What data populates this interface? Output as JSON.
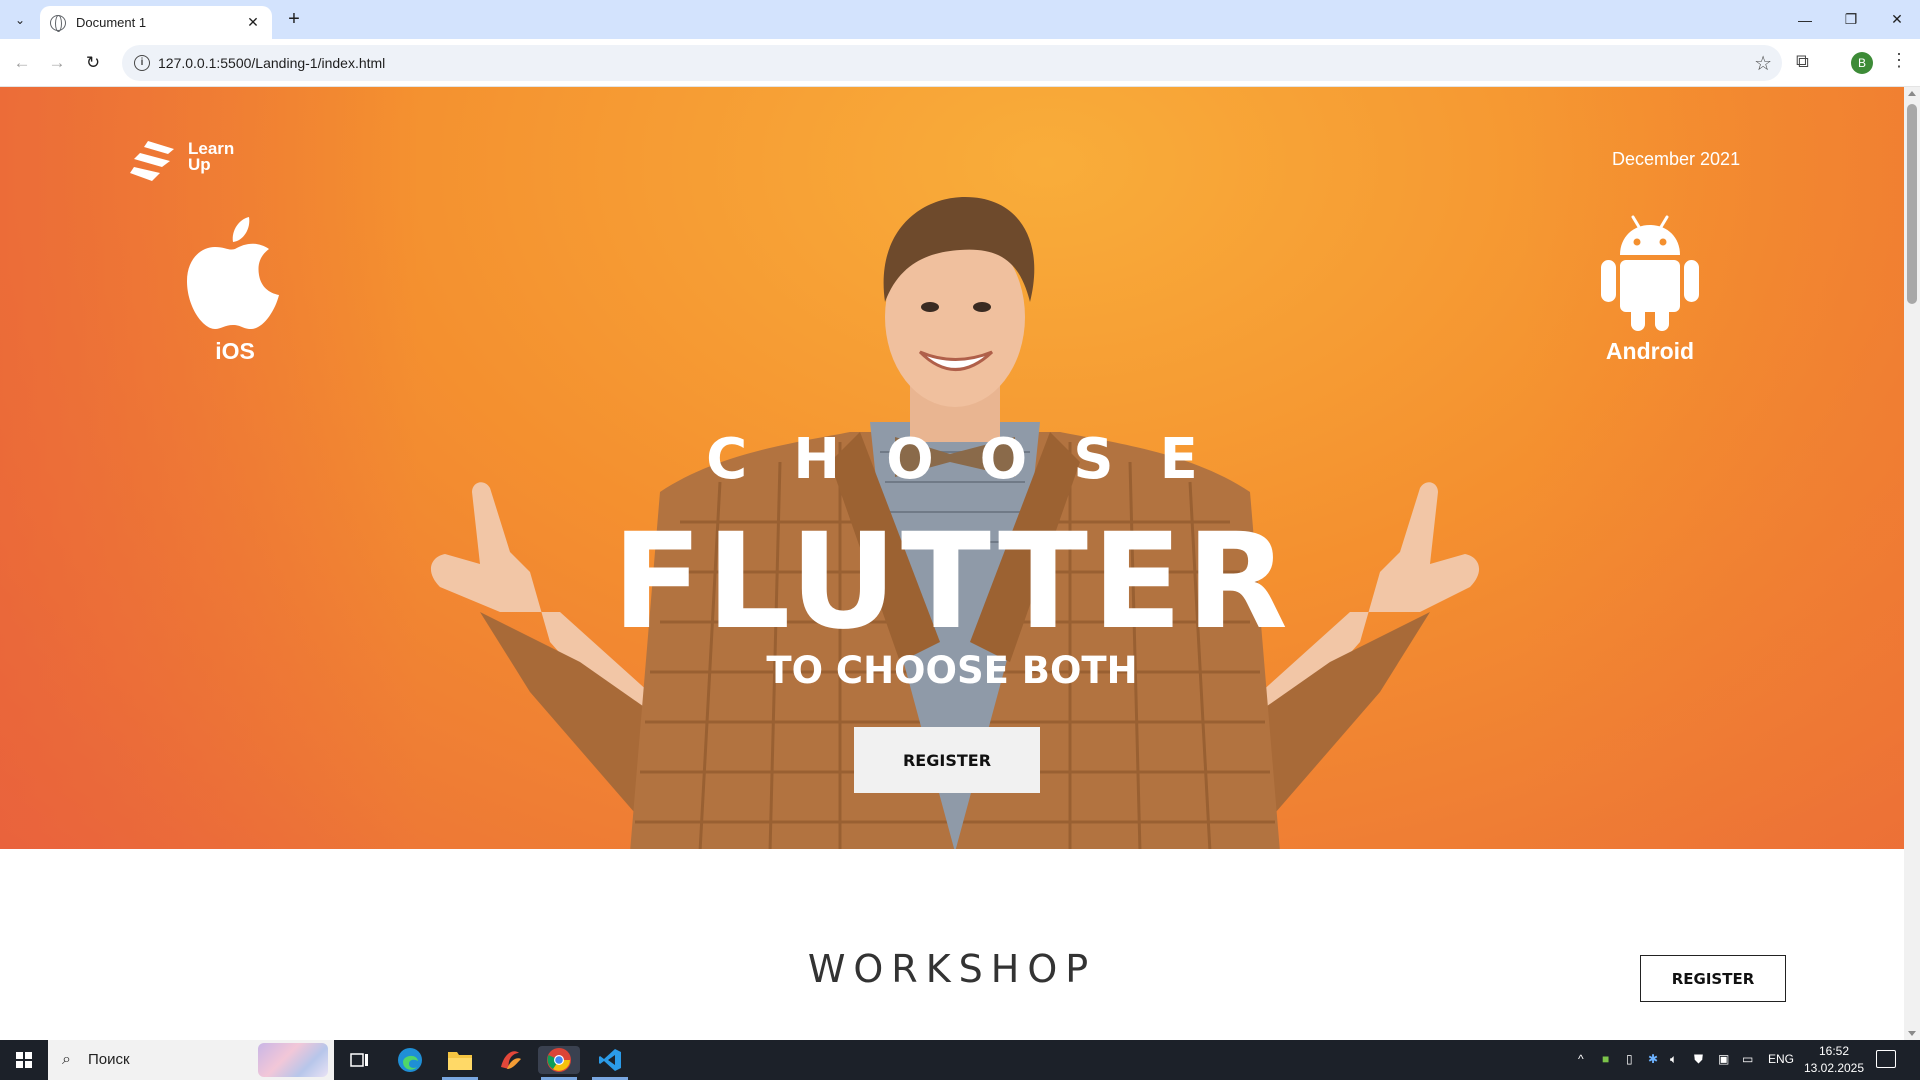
{
  "browser": {
    "tab_title": "Document 1",
    "tab_close": "✕",
    "new_tab": "+",
    "url": "127.0.0.1:5500/Landing-1/index.html",
    "profile_initial": "B",
    "window_controls": {
      "minimize": "—",
      "restore": "❐",
      "close": "✕"
    }
  },
  "page": {
    "logo": {
      "line1": "Learn",
      "line2": "Up"
    },
    "date": "December 2021",
    "platforms": {
      "ios": "iOS",
      "android": "Android"
    },
    "hero": {
      "choose": "CHOOSE",
      "flutter": "FLUTTER",
      "subtitle": "TO CHOOSE BOTH",
      "register_label": "REGISTER"
    },
    "workshop": {
      "title": "WORKSHOP",
      "register_label": "REGISTER"
    },
    "colors": {
      "hero_orange": "#f4902f",
      "hero_coral": "#ea6a3c"
    }
  },
  "taskbar": {
    "search_placeholder": "Поиск",
    "language": "ENG",
    "time": "16:52",
    "date": "13.02.2025"
  }
}
